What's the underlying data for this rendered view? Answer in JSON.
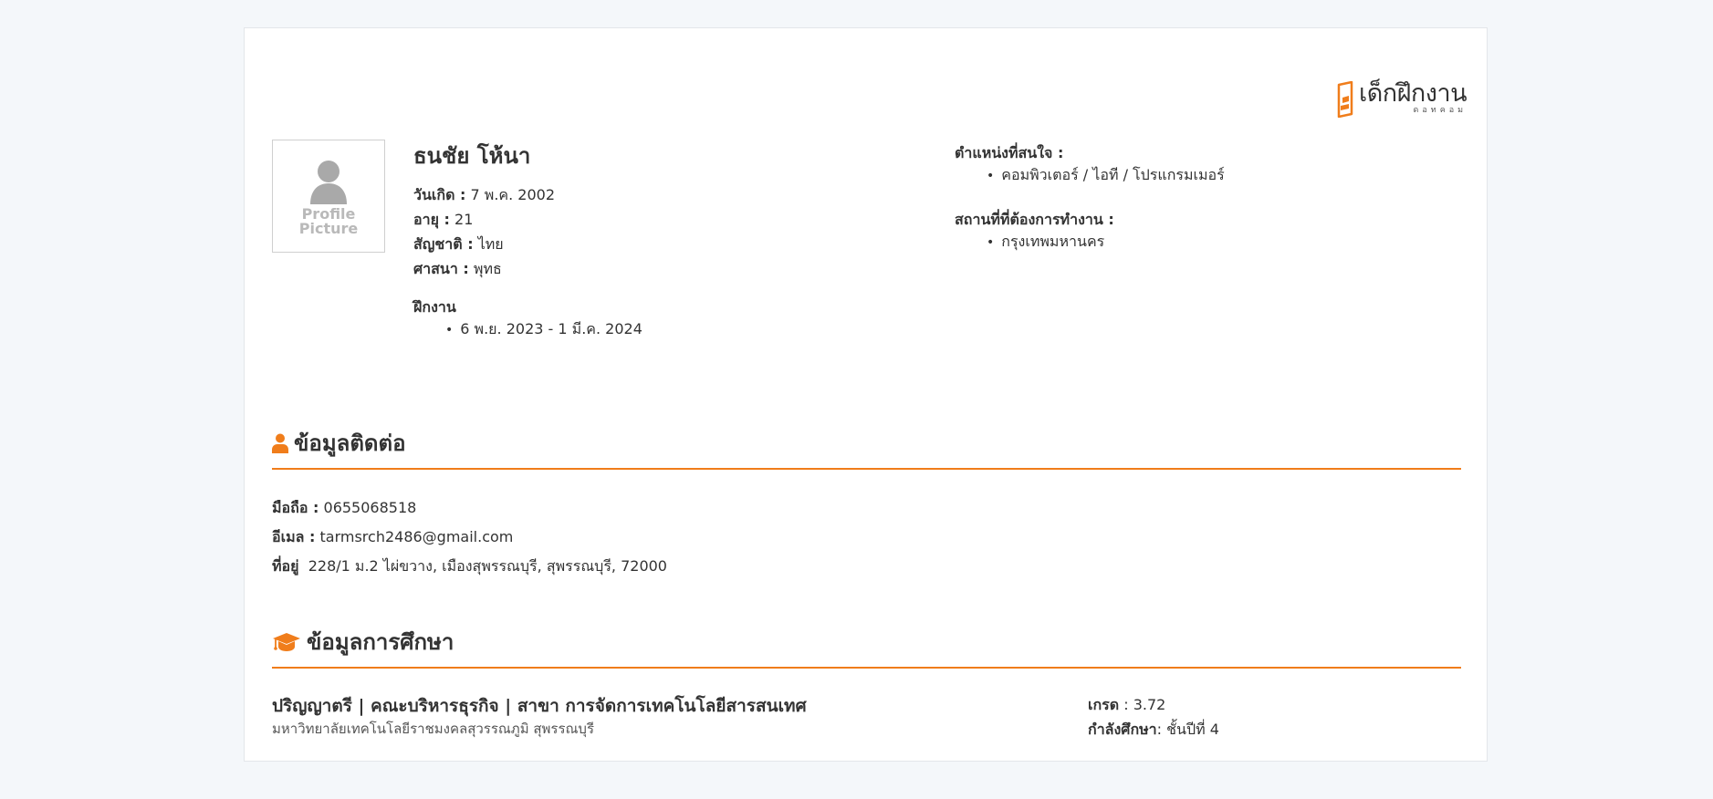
{
  "brand": {
    "name": "เด็กฝึกงาน",
    "sub": "ดอทคอม",
    "color": "#f07d1b"
  },
  "profile": {
    "avatar_text_1": "Profile",
    "avatar_text_2": "Picture",
    "name": "ธนชัย โห้นา",
    "birthdate_label": "วันเกิด :",
    "birthdate": "7 พ.ค. 2002",
    "age_label": "อายุ :",
    "age": "21",
    "nationality_label": "สัญชาติ :",
    "nationality": "ไทย",
    "religion_label": "ศาสนา :",
    "religion": "พุทธ",
    "internship_label": "ฝึกงาน",
    "internship_periods": [
      "6 พ.ย. 2023 - 1 มี.ค. 2024"
    ]
  },
  "preferences": {
    "positions_label": "ตำแหน่งที่สนใจ :",
    "positions": [
      "คอมพิวเตอร์ / ไอที / โปรแกรมเมอร์"
    ],
    "locations_label": "สถานที่ที่ต้องการทำงาน :",
    "locations": [
      "กรุงเทพมหานคร"
    ]
  },
  "contact": {
    "title": "ข้อมูลติดต่อ",
    "icon": "user-icon",
    "phone_label": "มือถือ :",
    "phone": "0655068518",
    "email_label": "อีเมล :",
    "email": "tarmsrch2486@gmail.com",
    "address_label": "ที่อยู่",
    "address": "228/1 ม.2 ไผ่ขวาง, เมืองสุพรรณบุรี, สุพรรณบุรี, 72000"
  },
  "education": {
    "title": "ข้อมูลการศึกษา",
    "icon": "graduation-cap-icon",
    "degree": "ปริญญาตรี | คณะบริหารธุรกิจ | สาขา การจัดการเทคโนโลยีสารสนเทศ",
    "university": "มหาวิทยาลัยเทคโนโลยีราชมงคลสุวรรณภูมิ สุพรรณบุรี",
    "gpa_label": "เกรด",
    "gpa": ": 3.72",
    "status_label": "กำลังศึกษา",
    "status": ": ชั้นปีที่ 4"
  }
}
